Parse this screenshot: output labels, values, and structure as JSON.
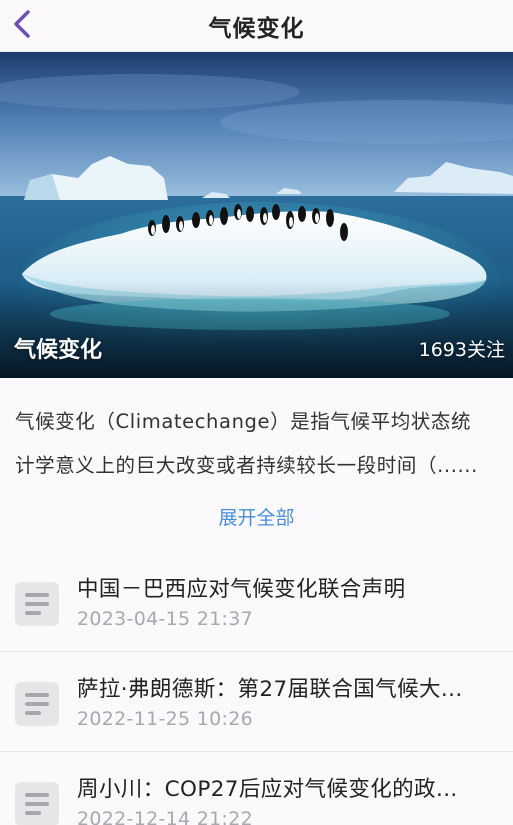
{
  "header": {
    "title": "气候变化"
  },
  "hero": {
    "title": "气候变化",
    "follow_count": "1693",
    "follow_suffix": "关注"
  },
  "description": {
    "line1": "气候变化（Climatechange）是指气候平均状态统",
    "line2": "计学意义上的巨大改变或者持续较长一段时间（......",
    "expand_label": "展开全部"
  },
  "articles": [
    {
      "title": "中国－巴西应对气候变化联合声明",
      "date": "2023-04-15 21:37"
    },
    {
      "title": "萨拉·弗朗德斯：第27届联合国气候大...",
      "date": "2022-11-25 10:26"
    },
    {
      "title": "周小川：COP27后应对气候变化的政...",
      "date": "2022-12-14 21:22"
    }
  ],
  "colors": {
    "accent": "#6a4fb0",
    "link": "#4a8fd6",
    "date": "#a9a9ad"
  },
  "icons": [
    "back-arrow-icon",
    "document-icon"
  ]
}
